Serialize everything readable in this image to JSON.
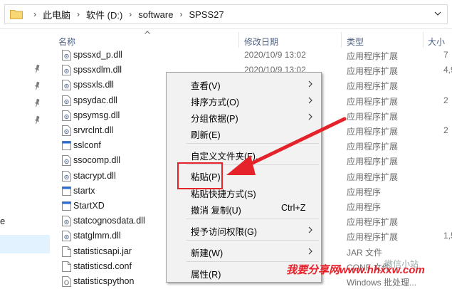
{
  "breadcrumb": {
    "items": [
      "此电脑",
      "软件 (D:)",
      "software",
      "SPSS27"
    ]
  },
  "columns": {
    "name": "名称",
    "date": "修改日期",
    "type": "类型",
    "size": "大小"
  },
  "nav": {
    "partial_text": "e"
  },
  "files": [
    {
      "name": "spssxd_p.dll",
      "date": "2020/10/9 13:02",
      "type": "应用程序扩展",
      "size": "7",
      "icon": "dll-icon"
    },
    {
      "name": "spssxdlm.dll",
      "date": "2020/10/9 13:02",
      "type": "应用程序扩展",
      "size": "4,9",
      "icon": "dll-icon"
    },
    {
      "name": "spssxls.dll",
      "date": "",
      "type": "应用程序扩展",
      "size": "",
      "icon": "dll-icon"
    },
    {
      "name": "spsydac.dll",
      "date": "",
      "type": "应用程序扩展",
      "size": "2",
      "icon": "dll-icon"
    },
    {
      "name": "spsymsg.dll",
      "date": "",
      "type": "应用程序扩展",
      "size": "",
      "icon": "dll-icon"
    },
    {
      "name": "srvrclnt.dll",
      "date": "",
      "type": "应用程序扩展",
      "size": "2",
      "icon": "dll-icon"
    },
    {
      "name": "sslconf",
      "date": "",
      "type": "应用程序扩展",
      "size": "",
      "icon": "exe-icon"
    },
    {
      "name": "ssocomp.dll",
      "date": "",
      "type": "应用程序扩展",
      "size": "",
      "icon": "dll-icon"
    },
    {
      "name": "stacrypt.dll",
      "date": "",
      "type": "应用程序扩展",
      "size": "",
      "icon": "dll-icon"
    },
    {
      "name": "startx",
      "date": "",
      "type": "应用程序",
      "size": "",
      "icon": "exe-icon"
    },
    {
      "name": "StartXD",
      "date": "",
      "type": "应用程序",
      "size": "",
      "icon": "exe-icon"
    },
    {
      "name": "statcognosdata.dll",
      "date": "",
      "type": "应用程序扩展",
      "size": "",
      "icon": "dll-icon"
    },
    {
      "name": "statglmm.dll",
      "date": "",
      "type": "应用程序扩展",
      "size": "1,5",
      "icon": "dll-icon"
    },
    {
      "name": "statisticsapi.jar",
      "date": "",
      "type": "JAR 文件",
      "size": "",
      "icon": "file-icon"
    },
    {
      "name": "statisticsd.conf",
      "date": "",
      "type": "CONF 文件",
      "size": "",
      "icon": "file-icon"
    },
    {
      "name": "statisticspython",
      "date": "",
      "type": "Windows 批处理...",
      "size": "",
      "icon": "bat-icon"
    }
  ],
  "context_menu": {
    "items": [
      {
        "label": "查看(V)",
        "submenu": true
      },
      {
        "label": "排序方式(O)",
        "submenu": true
      },
      {
        "label": "分组依据(P)",
        "submenu": true
      },
      {
        "label": "刷新(E)",
        "submenu": false
      },
      {
        "label": "自定义文件夹(F)...",
        "submenu": false
      },
      {
        "label": "粘贴(P)",
        "submenu": false
      },
      {
        "label": "粘贴快捷方式(S)",
        "submenu": false
      },
      {
        "label": "撤消 复制(U)",
        "submenu": false,
        "shortcut": "Ctrl+Z"
      },
      {
        "label": "授予访问权限(G)",
        "submenu": true
      },
      {
        "label": "新建(W)",
        "submenu": true
      },
      {
        "label": "属性(R)",
        "submenu": false
      }
    ]
  },
  "watermark": {
    "text": "我要分享网www.hhxxw.com",
    "faint_text": "微信小站"
  },
  "colors": {
    "accent_red": "#e4232a",
    "header_text": "#4d6082",
    "menu_bg": "#f2f2f2"
  }
}
